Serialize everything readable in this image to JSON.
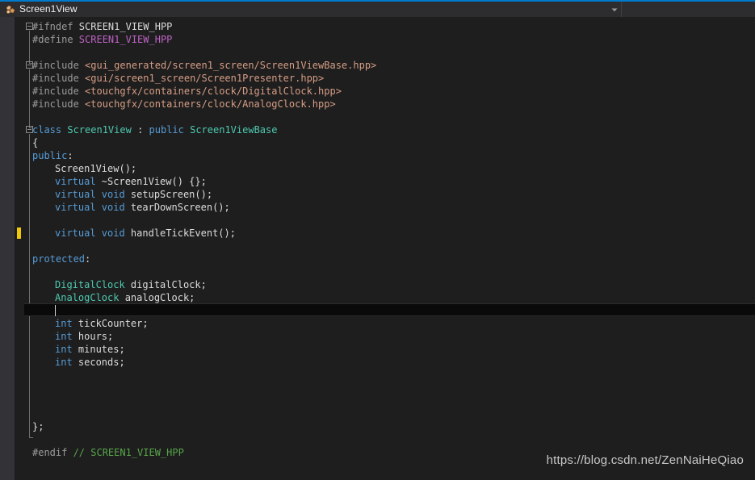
{
  "window": {
    "accent_color": "#007acc",
    "tab_background": "#2d2d30",
    "editor_background": "#1e1e1e"
  },
  "document_tab": {
    "title": "Screen1View",
    "icon": "cpp-header-file-icon",
    "dropdown_icon": "chevron-down-icon"
  },
  "editor": {
    "language": "cpp",
    "caret_line_index": 22,
    "change_marker_line_index": 16,
    "colors": {
      "preprocessor": "#9b9b9b",
      "macro": "#bd63c5",
      "include_path": "#d69d85",
      "keyword": "#569cd6",
      "type": "#4ec9b0",
      "comment": "#57a64a",
      "plain": "#dcdcdc",
      "current_line": "#0a0a0a",
      "change_marker": "#f0c808"
    },
    "lines": [
      {
        "indent": 0,
        "fold": "open",
        "tokens": [
          {
            "t": "#ifndef ",
            "c": "pre"
          },
          {
            "t": "SCREEN1_VIEW_HPP",
            "c": "plain"
          }
        ]
      },
      {
        "indent": 0,
        "tokens": [
          {
            "t": "#define ",
            "c": "pre"
          },
          {
            "t": "SCREEN1_VIEW_HPP",
            "c": "macro"
          }
        ]
      },
      {
        "indent": 0,
        "tokens": []
      },
      {
        "indent": 0,
        "fold": "open",
        "tokens": [
          {
            "t": "#include ",
            "c": "pre"
          },
          {
            "t": "<gui_generated/screen1_screen/Screen1ViewBase.hpp>",
            "c": "string"
          }
        ]
      },
      {
        "indent": 0,
        "tokens": [
          {
            "t": "#include ",
            "c": "pre"
          },
          {
            "t": "<gui/screen1_screen/Screen1Presenter.hpp>",
            "c": "string"
          }
        ]
      },
      {
        "indent": 0,
        "tokens": [
          {
            "t": "#include ",
            "c": "pre"
          },
          {
            "t": "<touchgfx/containers/clock/DigitalClock.hpp>",
            "c": "string"
          }
        ]
      },
      {
        "indent": 0,
        "tokens": [
          {
            "t": "#include ",
            "c": "pre"
          },
          {
            "t": "<touchgfx/containers/clock/AnalogClock.hpp>",
            "c": "string"
          }
        ]
      },
      {
        "indent": 0,
        "tokens": []
      },
      {
        "indent": 0,
        "fold": "open",
        "tokens": [
          {
            "t": "class ",
            "c": "keyword"
          },
          {
            "t": "Screen1View ",
            "c": "type"
          },
          {
            "t": ": ",
            "c": "plain"
          },
          {
            "t": "public ",
            "c": "keyword"
          },
          {
            "t": "Screen1ViewBase",
            "c": "type"
          }
        ]
      },
      {
        "indent": 0,
        "tokens": [
          {
            "t": "{",
            "c": "plain"
          }
        ]
      },
      {
        "indent": 0,
        "tokens": [
          {
            "t": "public",
            "c": "keyword"
          },
          {
            "t": ":",
            "c": "plain"
          }
        ]
      },
      {
        "indent": 1,
        "tokens": [
          {
            "t": "Screen1View();",
            "c": "plain"
          }
        ]
      },
      {
        "indent": 1,
        "tokens": [
          {
            "t": "virtual ",
            "c": "keyword"
          },
          {
            "t": "~Screen1View() {};",
            "c": "plain"
          }
        ]
      },
      {
        "indent": 1,
        "tokens": [
          {
            "t": "virtual ",
            "c": "keyword"
          },
          {
            "t": "void ",
            "c": "keyword"
          },
          {
            "t": "setupScreen();",
            "c": "plain"
          }
        ]
      },
      {
        "indent": 1,
        "tokens": [
          {
            "t": "virtual ",
            "c": "keyword"
          },
          {
            "t": "void ",
            "c": "keyword"
          },
          {
            "t": "tearDownScreen();",
            "c": "plain"
          }
        ]
      },
      {
        "indent": 0,
        "tokens": []
      },
      {
        "indent": 1,
        "tokens": [
          {
            "t": "virtual ",
            "c": "keyword"
          },
          {
            "t": "void ",
            "c": "keyword"
          },
          {
            "t": "handleTickEvent();",
            "c": "plain"
          }
        ]
      },
      {
        "indent": 0,
        "tokens": []
      },
      {
        "indent": 0,
        "tokens": [
          {
            "t": "protected",
            "c": "keyword"
          },
          {
            "t": ":",
            "c": "plain"
          }
        ]
      },
      {
        "indent": 0,
        "tokens": []
      },
      {
        "indent": 1,
        "tokens": [
          {
            "t": "DigitalClock ",
            "c": "type"
          },
          {
            "t": "digitalClock;",
            "c": "plain"
          }
        ]
      },
      {
        "indent": 1,
        "tokens": [
          {
            "t": "AnalogClock ",
            "c": "type"
          },
          {
            "t": "analogClock;",
            "c": "plain"
          }
        ]
      },
      {
        "indent": 1,
        "tokens": []
      },
      {
        "indent": 1,
        "tokens": [
          {
            "t": "int ",
            "c": "keyword"
          },
          {
            "t": "tickCounter;",
            "c": "plain"
          }
        ]
      },
      {
        "indent": 1,
        "tokens": [
          {
            "t": "int ",
            "c": "keyword"
          },
          {
            "t": "hours;",
            "c": "plain"
          }
        ]
      },
      {
        "indent": 1,
        "tokens": [
          {
            "t": "int ",
            "c": "keyword"
          },
          {
            "t": "minutes;",
            "c": "plain"
          }
        ]
      },
      {
        "indent": 1,
        "tokens": [
          {
            "t": "int ",
            "c": "keyword"
          },
          {
            "t": "seconds;",
            "c": "plain"
          }
        ]
      },
      {
        "indent": 0,
        "tokens": []
      },
      {
        "indent": 0,
        "tokens": []
      },
      {
        "indent": 0,
        "tokens": []
      },
      {
        "indent": 0,
        "tokens": []
      },
      {
        "indent": 0,
        "tokens": [
          {
            "t": "};",
            "c": "plain"
          }
        ]
      },
      {
        "indent": 0,
        "tokens": []
      },
      {
        "indent": 0,
        "tokens": [
          {
            "t": "#endif ",
            "c": "pre"
          },
          {
            "t": "// SCREEN1_VIEW_HPP",
            "c": "comment"
          }
        ]
      }
    ]
  },
  "watermark": {
    "text": "https://blog.csdn.net/ZenNaiHeQiao"
  }
}
